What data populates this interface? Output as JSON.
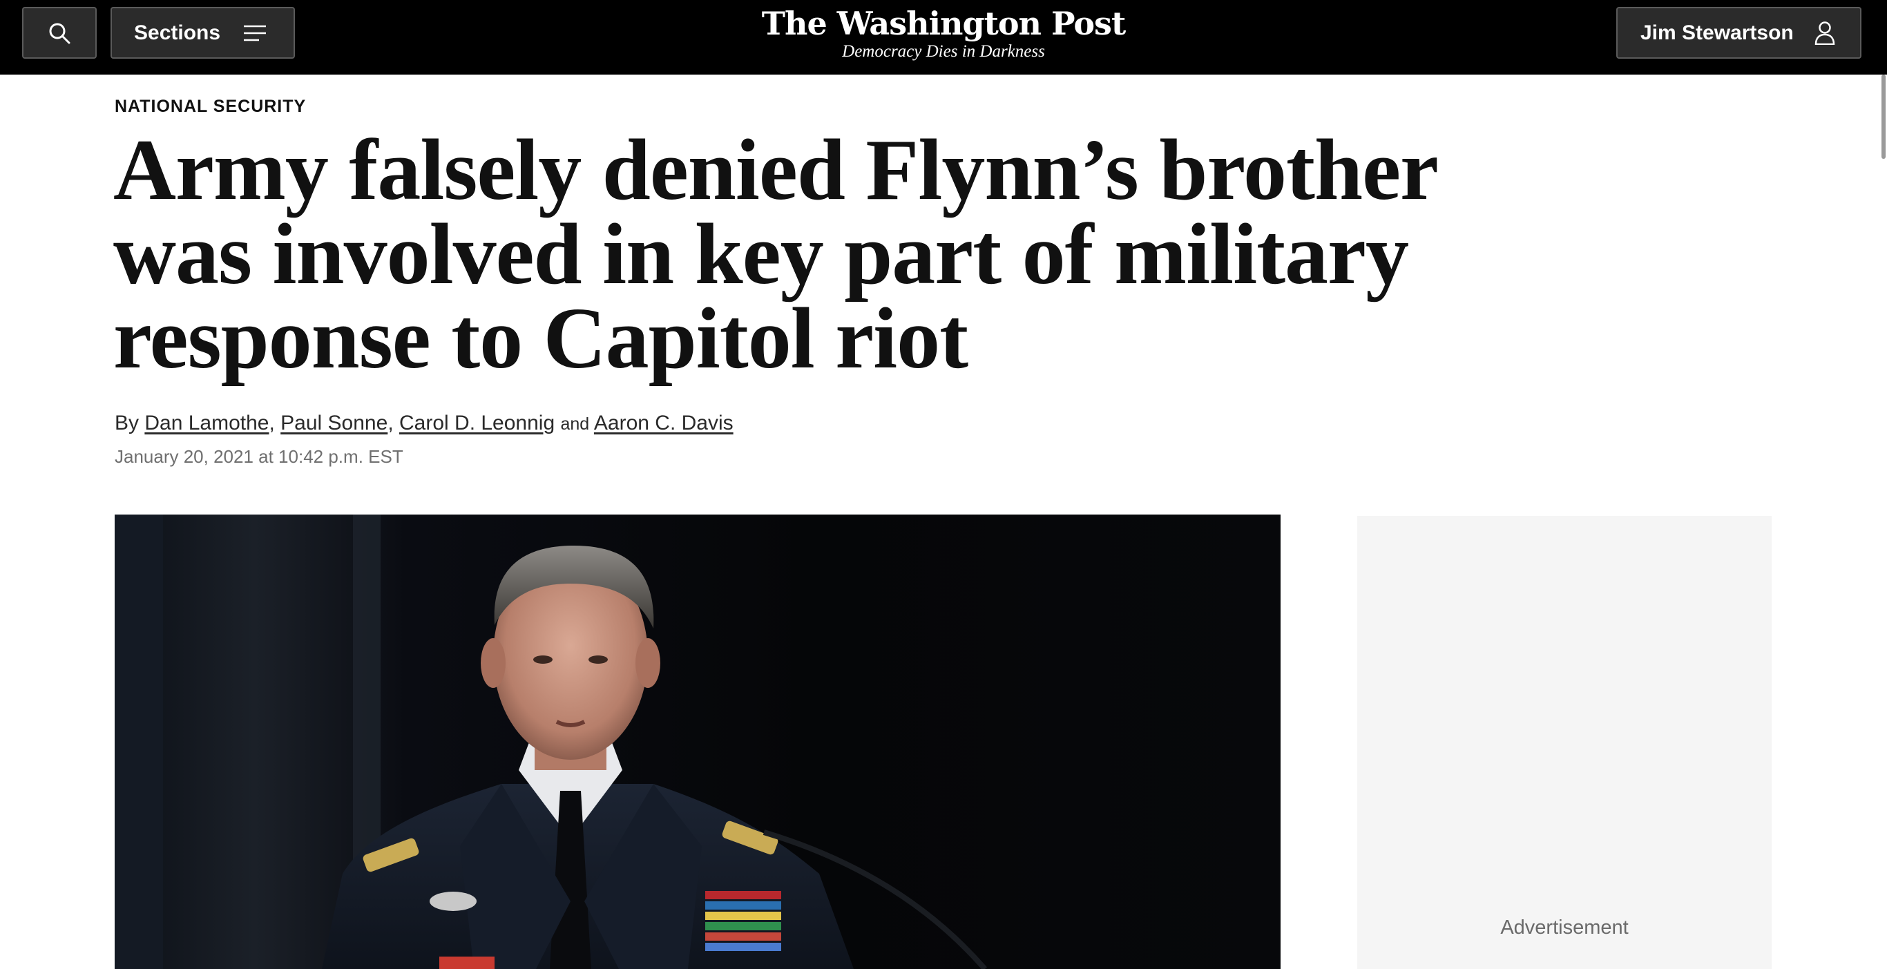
{
  "header": {
    "search_icon": "search-icon",
    "sections_label": "Sections",
    "sections_icon": "hamburger-menu-icon",
    "masthead_title": "The Washington Post",
    "masthead_tagline": "Democracy Dies in Darkness",
    "user_name": "Jim Stewartson",
    "user_icon": "user-icon"
  },
  "article": {
    "kicker": "NATIONAL SECURITY",
    "headline": "Army falsely denied Flynn’s brother was involved in key part of military response to Capitol riot",
    "byline": {
      "prefix": "By",
      "authors": [
        "Dan Lamothe",
        "Paul Sonne",
        "Carol D. Leonnig",
        "Aaron C. Davis"
      ],
      "separator": ",",
      "conjunction": "and"
    },
    "date": "January 20, 2021 at 10:42 p.m. EST"
  },
  "sidebar": {
    "ad_label": "Advertisement"
  },
  "colors": {
    "header_bg": "#000000",
    "header_button_bg": "#2b2b2b",
    "ad_bg": "#f5f5f5"
  }
}
